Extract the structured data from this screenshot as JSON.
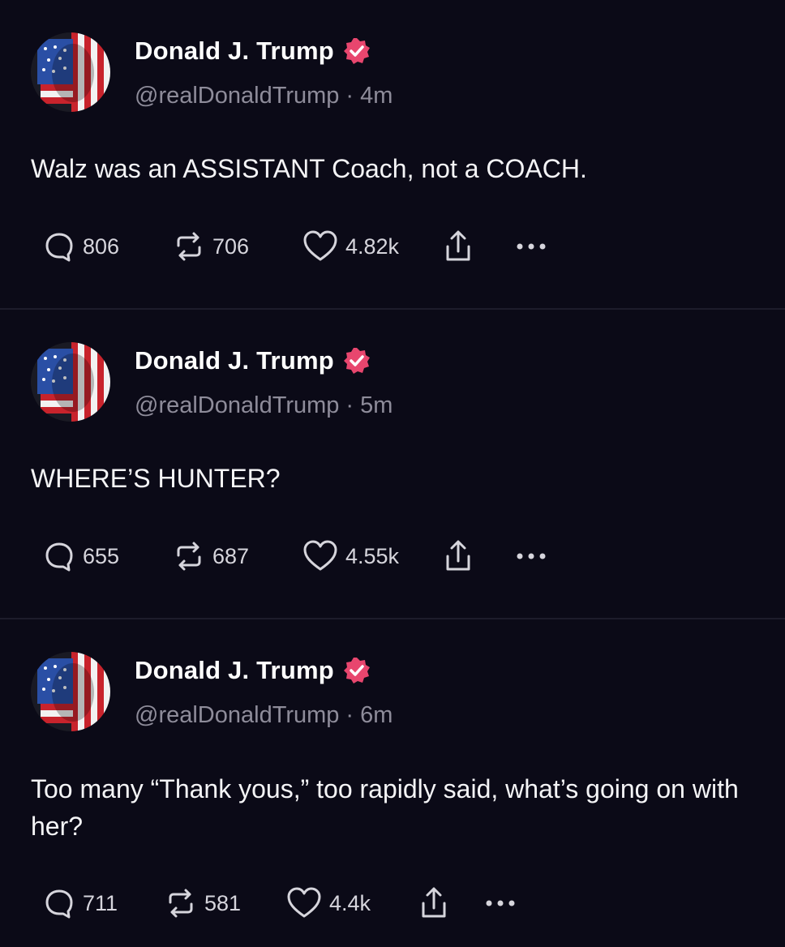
{
  "colors": {
    "background": "#0b0a17",
    "verified_badge": "#e8466e",
    "secondary_text": "#8e8c9a"
  },
  "posts": [
    {
      "author": "Donald J. Trump",
      "handle": "@realDonaldTrump",
      "separator": "·",
      "time": "4m",
      "text": "Walz was an ASSISTANT Coach, not a COACH.",
      "replies": "806",
      "reposts": "706",
      "likes": "4.82k"
    },
    {
      "author": "Donald J. Trump",
      "handle": "@realDonaldTrump",
      "separator": "·",
      "time": "5m",
      "text": "WHERE’S HUNTER?",
      "replies": "655",
      "reposts": "687",
      "likes": "4.55k"
    },
    {
      "author": "Donald J. Trump",
      "handle": "@realDonaldTrump",
      "separator": "·",
      "time": "6m",
      "text": "Too many “Thank yous,” too rapidly said, what’s going on with her?",
      "replies": "711",
      "reposts": "581",
      "likes": "4.4k"
    }
  ],
  "icons": {
    "reply": "reply-icon",
    "repost": "repost-icon",
    "like": "heart-icon",
    "share": "share-icon",
    "more": "more-icon",
    "verified": "verified-badge-icon"
  }
}
